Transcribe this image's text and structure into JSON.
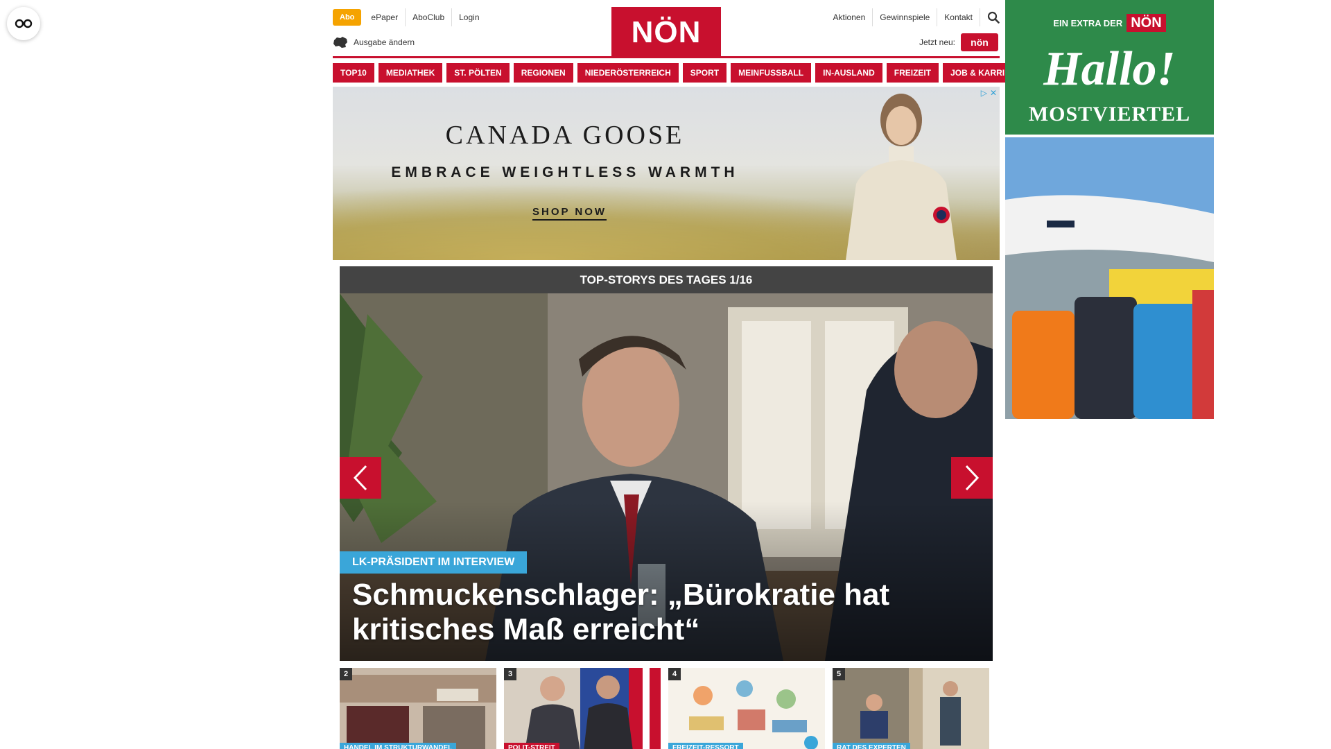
{
  "header": {
    "abo_label": "Abo",
    "top_links_left": [
      "ePaper",
      "AboClub",
      "Login"
    ],
    "ausgabe_label": "Ausgabe ändern",
    "logo_text": "NÖN",
    "top_links_right": [
      "Aktionen",
      "Gewinnspiele",
      "Kontakt"
    ],
    "jetzt_neu_label": "Jetzt neu:",
    "jetzt_neu_logo": "nön"
  },
  "nav": {
    "items": [
      "TOP10",
      "MEDIATHEK",
      "ST. PÖLTEN",
      "REGIONEN",
      "NIEDERÖSTERREICH",
      "SPORT",
      "MEINFUSSBALL",
      "IN-AUSLAND",
      "FREIZEIT",
      "JOB & KARRIERE"
    ]
  },
  "ad_banner": {
    "brand": "CANADA GOOSE",
    "tagline": "EMBRACE WEIGHTLESS WARMTH",
    "cta": "SHOP NOW"
  },
  "stories": {
    "heading": "TOP-STORYS DES TAGES 1/16",
    "hero": {
      "kicker": "LK-PRÄSIDENT IM INTERVIEW",
      "title": "Schmuckenschlager: „Bürokratie hat kritisches Maß erreicht“"
    },
    "thumbs": [
      {
        "num": "2",
        "kicker": "HANDEL IM STRUKTURWANDEL",
        "kicker_color": "#3aa6d9"
      },
      {
        "num": "3",
        "kicker": "POLIT-STREIT",
        "kicker_color": "#c8102e"
      },
      {
        "num": "4",
        "kicker": "FREIZEIT-RESSORT",
        "kicker_color": "#3aa6d9"
      },
      {
        "num": "5",
        "kicker": "RAT DES EXPERTEN",
        "kicker_color": "#3aa6d9"
      }
    ]
  },
  "side_ad": {
    "top_text": "EIN EXTRA DER",
    "noen": "NÖN",
    "title": "Hallo!",
    "subtitle": "MOSTVIERTEL"
  },
  "colors": {
    "brand_red": "#c8102e",
    "abo_orange": "#f5a300",
    "kicker_blue": "#3aa6d9",
    "side_green": "#2e8a4a"
  }
}
